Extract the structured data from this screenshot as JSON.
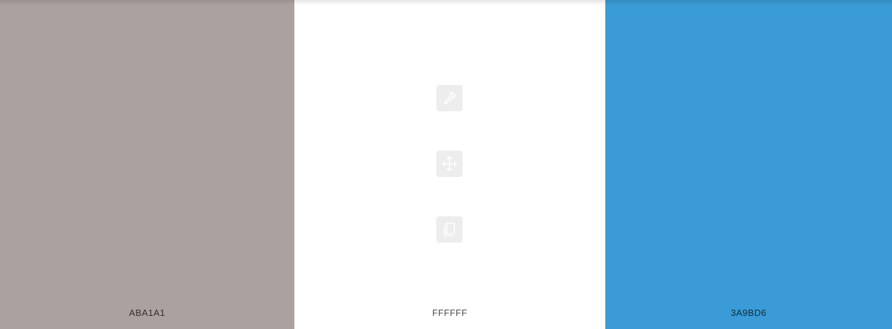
{
  "swatches": [
    {
      "hex": "ABA1A1",
      "color": "#ABA1A1"
    },
    {
      "hex": "FFFFFF",
      "color": "#FFFFFF"
    },
    {
      "hex": "3A9BD6",
      "color": "#3A9BD6"
    }
  ],
  "tools": [
    {
      "icon": "eyedropper-icon"
    },
    {
      "icon": "move-arrows-icon"
    },
    {
      "icon": "copy-icon"
    }
  ]
}
